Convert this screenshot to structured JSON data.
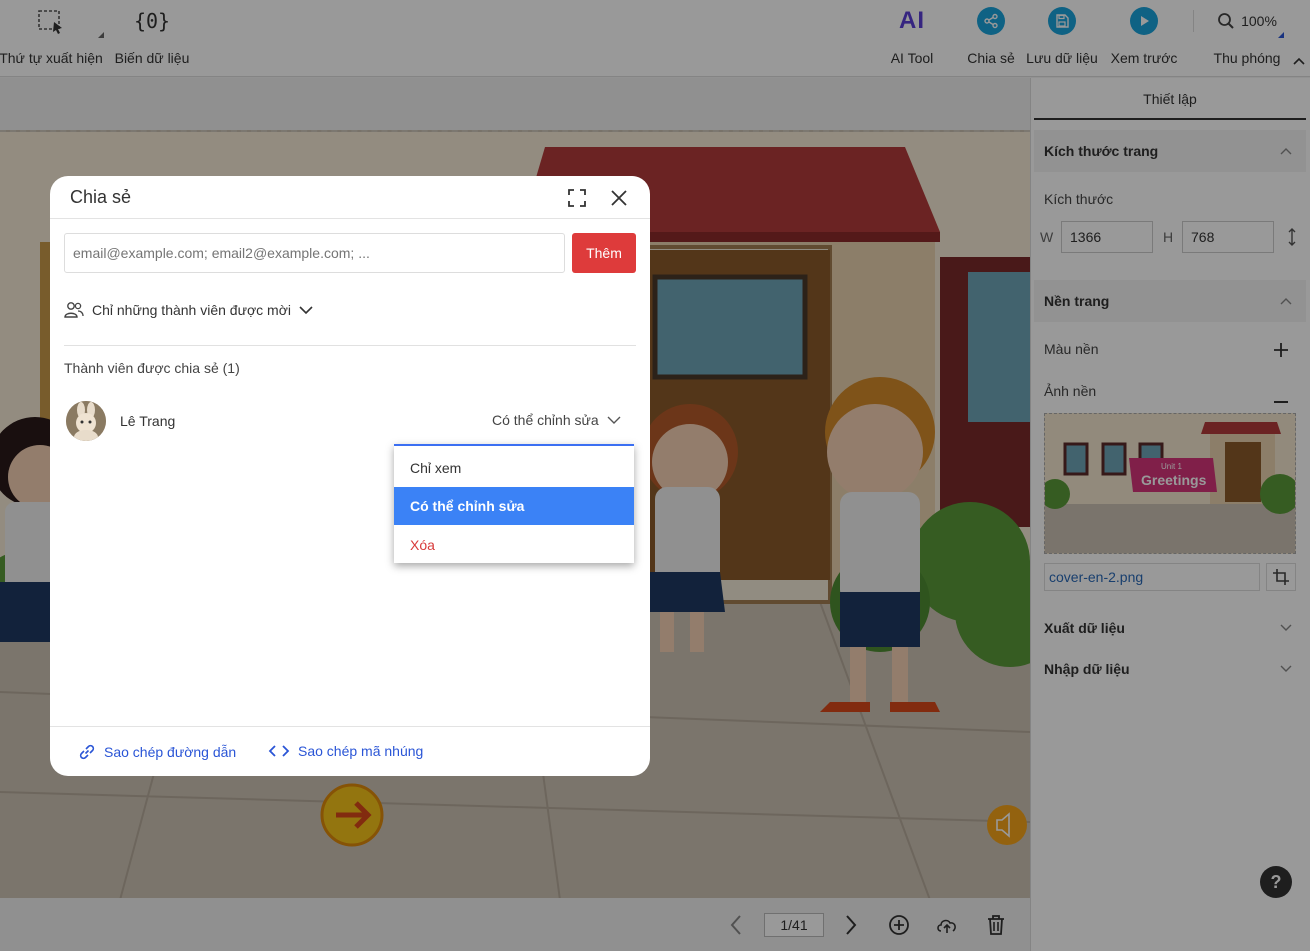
{
  "toolbar": {
    "order_label": "Thứ tự xuất hiện",
    "variables_icon_text": "{0}",
    "variables_label": "Biến dữ liệu",
    "ai_icon_text": "AI",
    "ai_label": "AI Tool",
    "share_label": "Chia sẻ",
    "save_label": "Lưu dữ liệu",
    "preview_label": "Xem trước",
    "zoom_value": "100%",
    "zoom_label": "Thu phóng"
  },
  "right_panel": {
    "tab": "Thiết lập",
    "page_size_title": "Kích thước trang",
    "size_label": "Kích thước",
    "w_label": "W",
    "w_value": "1366",
    "h_label": "H",
    "h_value": "768",
    "background_title": "Nền trang",
    "bg_color_label": "Màu nền",
    "bg_image_label": "Ảnh nền",
    "thumb_unit": "Unit 1",
    "thumb_title": "Greetings",
    "file_name": "cover-en-2.png",
    "export_title": "Xuất dữ liệu",
    "import_title": "Nhập dữ liệu",
    "help": "?"
  },
  "bottom_nav": {
    "page": "1/41"
  },
  "dialog": {
    "title": "Chia sẻ",
    "email_placeholder": "email@example.com; email2@example.com; ...",
    "add_button": "Thêm",
    "access_mode": "Chỉ những thành viên được mời",
    "members_title": "Thành viên được chia sẻ (1)",
    "member": {
      "name": "Lê Trang",
      "permission": "Có thể chỉnh sửa"
    },
    "copy_link": "Sao chép đường dẫn",
    "copy_embed": "Sao chép mã nhúng"
  },
  "permission_menu": {
    "items": [
      "Chỉ xem",
      "Có thể chỉnh sửa",
      "Xóa"
    ],
    "selected": "Có thể chỉnh sửa"
  },
  "colors": {
    "accent": "#3b82f6",
    "danger": "#de3b3b",
    "share_icon": "#1aa3dc",
    "link": "#2a55d6"
  }
}
